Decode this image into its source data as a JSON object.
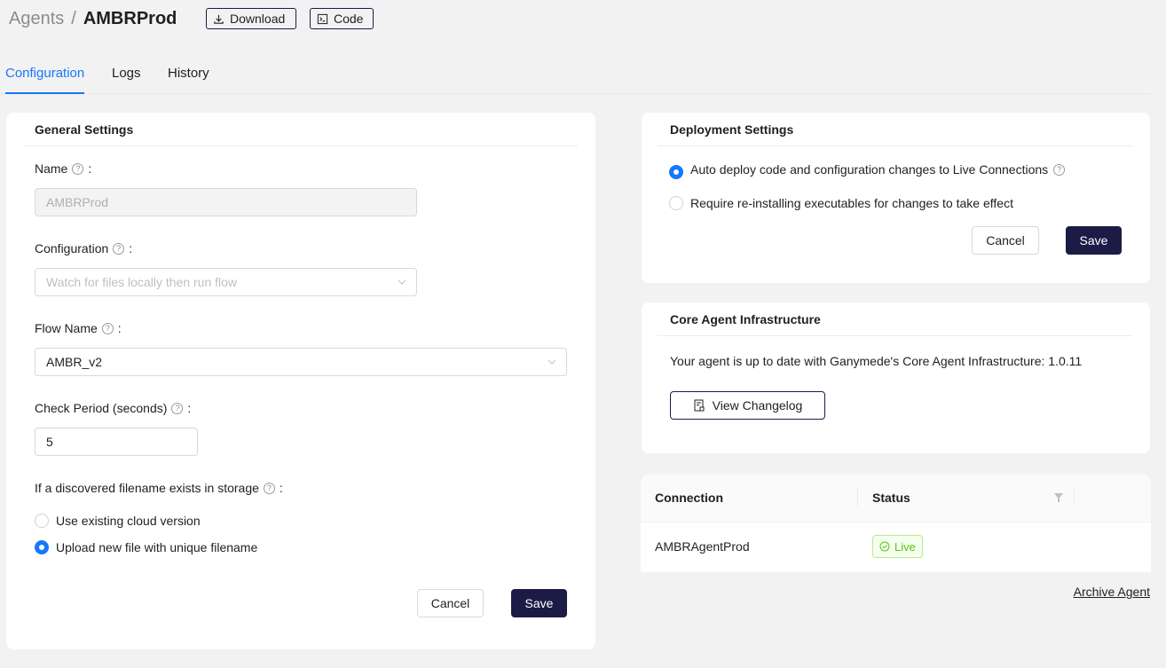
{
  "breadcrumb": {
    "root": "Agents",
    "separator": "/",
    "current": "AMBRProd"
  },
  "header_buttons": {
    "download": "Download",
    "code": "Code"
  },
  "tabs": [
    {
      "label": "Configuration",
      "active": true
    },
    {
      "label": "Logs",
      "active": false
    },
    {
      "label": "History",
      "active": false
    }
  ],
  "general_settings": {
    "title": "General Settings",
    "name": {
      "label": "Name",
      "value": "AMBRProd",
      "disabled": true
    },
    "configuration": {
      "label": "Configuration",
      "placeholder": "Watch for files locally then run flow"
    },
    "flow_name": {
      "label": "Flow Name",
      "value": "AMBR_v2"
    },
    "check_period": {
      "label": "Check Period (seconds)",
      "value": "5"
    },
    "filename_exists": {
      "label": "If a discovered filename exists in storage",
      "options": [
        {
          "label": "Use existing cloud version",
          "checked": false
        },
        {
          "label": "Upload new file with unique filename",
          "checked": true
        }
      ]
    },
    "cancel": "Cancel",
    "save": "Save"
  },
  "deployment_settings": {
    "title": "Deployment Settings",
    "options": [
      {
        "label": "Auto deploy code and configuration changes to Live Connections",
        "checked": true
      },
      {
        "label": "Require re-installing executables for changes to take effect",
        "checked": false
      }
    ],
    "cancel": "Cancel",
    "save": "Save"
  },
  "core_infrastructure": {
    "title": "Core Agent Infrastructure",
    "message": "Your agent is up to date with Ganymede's Core Agent Infrastructure: 1.0.11",
    "changelog_button": "View Changelog"
  },
  "connections_table": {
    "columns": [
      "Connection",
      "Status"
    ],
    "rows": [
      {
        "connection": "AMBRAgentProd",
        "status": "Live"
      }
    ]
  },
  "archive_link": "Archive Agent",
  "colors": {
    "accent": "#1677ff",
    "primary_button": "#1c1b46",
    "live_green": "#52c41a"
  },
  "help_glyph": "?",
  "label_suffix": ":"
}
